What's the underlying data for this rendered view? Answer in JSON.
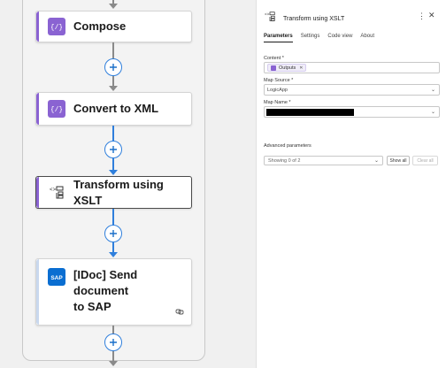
{
  "canvas": {
    "actions": [
      {
        "title": "Compose",
        "icon": "compose-icon",
        "accent": "#8a63d2"
      },
      {
        "title": "Convert to XML",
        "icon": "convert-icon",
        "accent": "#8a63d2"
      },
      {
        "title": "Transform using XSLT",
        "icon": "transform-xslt-icon",
        "accent": "#8a63d2"
      },
      {
        "title_line1": "[IDoc] Send document",
        "title_line2": "to SAP",
        "icon": "sap-icon",
        "accent": "#0a6ed1",
        "sap_text": "SAP"
      }
    ],
    "colors": {
      "connector_gray": "#8a8a8a",
      "connector_blue": "#2f7fdc",
      "selection_border": "#4a4a4a"
    }
  },
  "panel": {
    "title": "Transform using XSLT",
    "tabs": [
      "Parameters",
      "Settings",
      "Code view",
      "About"
    ],
    "active_tab": "Parameters",
    "fields": {
      "content_label": "Content *",
      "content_token": "Outputs",
      "map_source_label": "Map Source *",
      "map_source_value": "LogicApp",
      "map_name_label": "Map Name *"
    },
    "advanced": {
      "label": "Advanced parameters",
      "select_value": "Showing 0 of 2",
      "show_all": "Show all",
      "clear_all": "Clear all"
    }
  }
}
